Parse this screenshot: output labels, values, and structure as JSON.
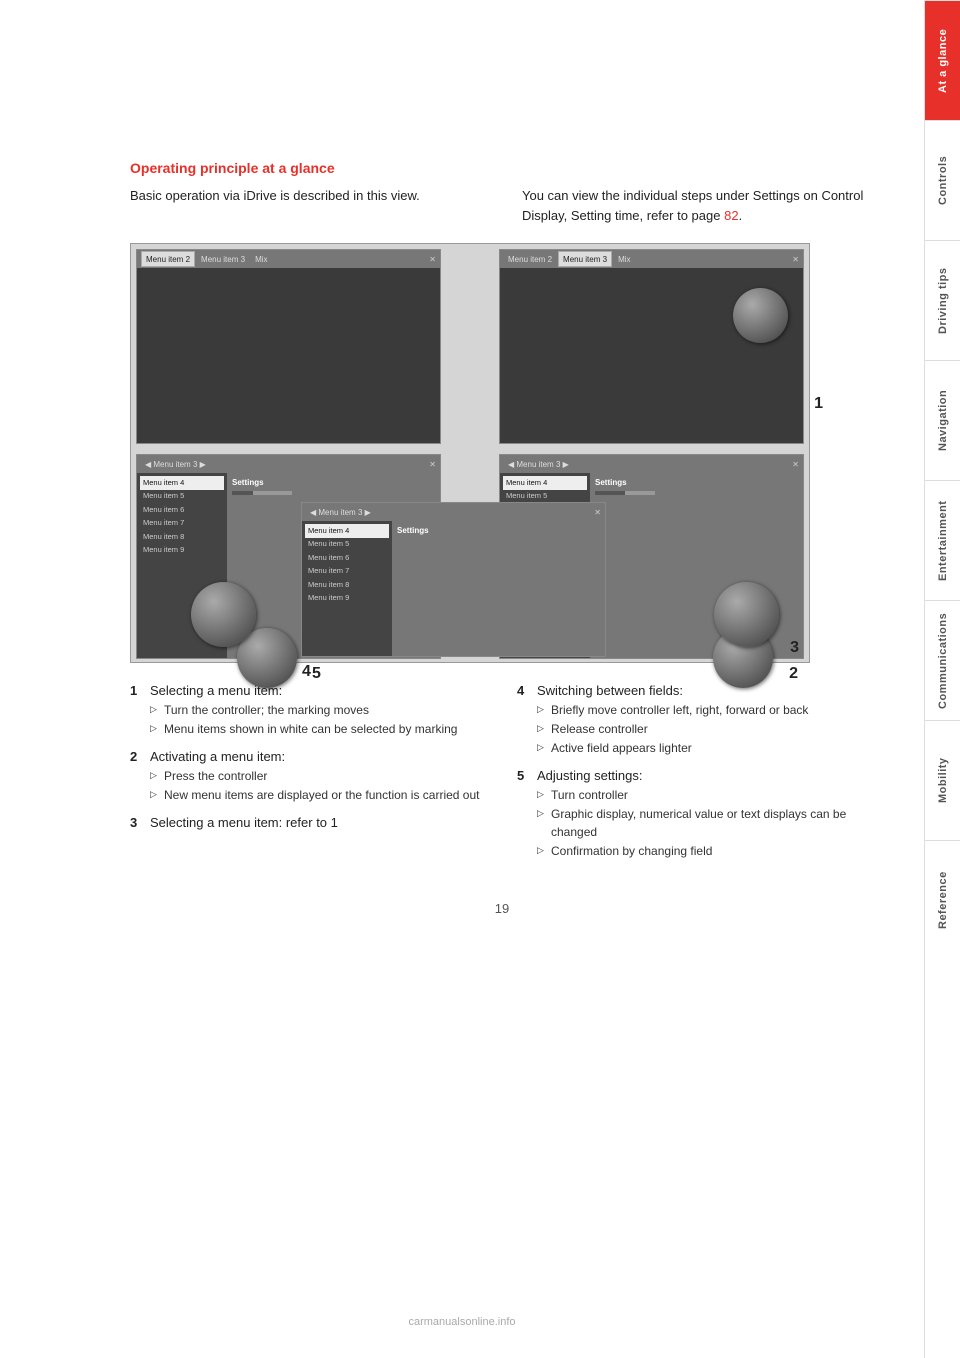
{
  "page": {
    "number": "19",
    "watermark": "carmanualsonline.info"
  },
  "section": {
    "title": "Operating principle at a glance",
    "intro_left": "Basic operation via iDrive is described in this view.",
    "intro_right": "You can view the individual steps under Settings on Control Display, Setting time, refer to page",
    "intro_link": "82",
    "intro_after": "."
  },
  "sidebar_tabs": [
    {
      "label": "At a glance",
      "active": true
    },
    {
      "label": "Controls",
      "active": false
    },
    {
      "label": "Driving tips",
      "active": false
    },
    {
      "label": "Navigation",
      "active": false
    },
    {
      "label": "Entertainment",
      "active": false
    },
    {
      "label": "Communications",
      "active": false
    },
    {
      "label": "Mobility",
      "active": false
    },
    {
      "label": "Reference",
      "active": false
    }
  ],
  "diagram": {
    "panels": [
      {
        "id": "top-left",
        "label": "Panel top-left"
      },
      {
        "id": "top-right",
        "label": "Panel top-right"
      },
      {
        "id": "bottom-left",
        "label": "Panel bottom-left"
      },
      {
        "id": "bottom-center",
        "label": "Panel bottom-center"
      },
      {
        "id": "bottom-right",
        "label": "Panel bottom-right"
      }
    ],
    "menu_items": [
      "Menu item 4",
      "Menu item 5",
      "Menu item 6",
      "Menu item 7",
      "Menu item 8",
      "Menu item 9"
    ],
    "top_bar_items": [
      "Menu item 2",
      "Menu item 3",
      "Mix"
    ],
    "settings_label": "Settings"
  },
  "instructions": [
    {
      "number": "1",
      "title": "Selecting a menu item:",
      "bullets": [
        "Turn the controller; the marking moves",
        "Menu items shown in white can be selected by marking"
      ]
    },
    {
      "number": "2",
      "title": "Activating a menu item:",
      "bullets": [
        "Press the controller",
        "New menu items are displayed or the function is carried out"
      ]
    },
    {
      "number": "3",
      "title": "Selecting a menu item: refer to 1",
      "bullets": []
    },
    {
      "number": "4",
      "title": "Switching between fields:",
      "bullets": [
        "Briefly move controller left, right, forward or back",
        "Release controller",
        "Active field appears lighter"
      ]
    },
    {
      "number": "5",
      "title": "Adjusting settings:",
      "bullets": [
        "Turn controller",
        "Graphic display, numerical value or text displays can be changed",
        "Confirmation by changing field"
      ]
    }
  ]
}
